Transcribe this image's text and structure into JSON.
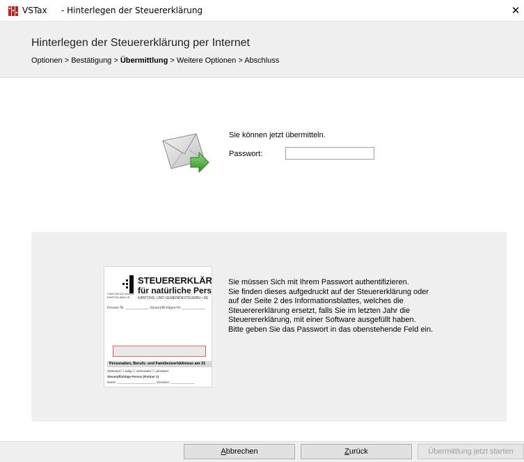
{
  "window": {
    "app_name": "VSTax",
    "title": "- Hinterlegen der Steuererklärung",
    "close_glyph": "✕"
  },
  "header": {
    "title": "Hinterlegen der Steuererklärung per Internet",
    "breadcrumb": [
      {
        "label": "Optionen",
        "active": false
      },
      {
        "label": "Bestätigung",
        "active": false
      },
      {
        "label": "Übermittlung",
        "active": true
      },
      {
        "label": "Weitere Optionen",
        "active": false
      },
      {
        "label": "Abschluss",
        "active": false
      }
    ],
    "separator": " > "
  },
  "transmit": {
    "icon": "mail-send-icon",
    "ready_text": "Sie können jetzt übermitteln.",
    "password_label": "Passwort:",
    "password_value": ""
  },
  "info": {
    "lines": [
      "Sie müssen Sich mit Ihrem Passwort authentifizieren.",
      "Sie finden dieses aufgedruckt auf der Steuererklärung oder",
      "auf der Seite 2 des Informationsblattes, welches die",
      "Steuerererklärung ersetzt, falls Sie im letzten Jahr die",
      "Steuerererklärung, mit einer Software ausgefüllt haben.",
      "Bitte geben Sie das Passwort in das obenstehende Feld ein."
    ],
    "form_preview": {
      "title": "STEUERERKLÄR",
      "subtitle": "für natürliche Pers",
      "line1": "KANTONS- UND GEMEINDESTEUERN  •  DE",
      "canton": "CANTON DU VALAIS\nKANTON WALLIS",
      "dossier": "Dossier-Nr. ____________   Steuerpflichtigen-Nr. ____________",
      "section": "Personalien, Berufs- und Familienverhältnisse am 31",
      "rows": [
        "Zivilstand     ☐ ledig          ☐ verheiratet       ☐ verwitwet",
        "Steuerpflichtige Person (Partner 1)",
        "Name: ______________________   Vorname: ______________"
      ]
    }
  },
  "footer": {
    "cancel": {
      "before": "",
      "mnemonic": "A",
      "after": "bbrechen"
    },
    "back": {
      "before": "",
      "mnemonic": "Z",
      "after": "urück"
    },
    "start": "Übermittlung jetzt starten"
  },
  "colors": {
    "header_bg": "#f0f0f0",
    "panel_bg": "#f0f0f0",
    "arrow_green": "#3fa535",
    "app_icon_red": "#c41e1e"
  }
}
